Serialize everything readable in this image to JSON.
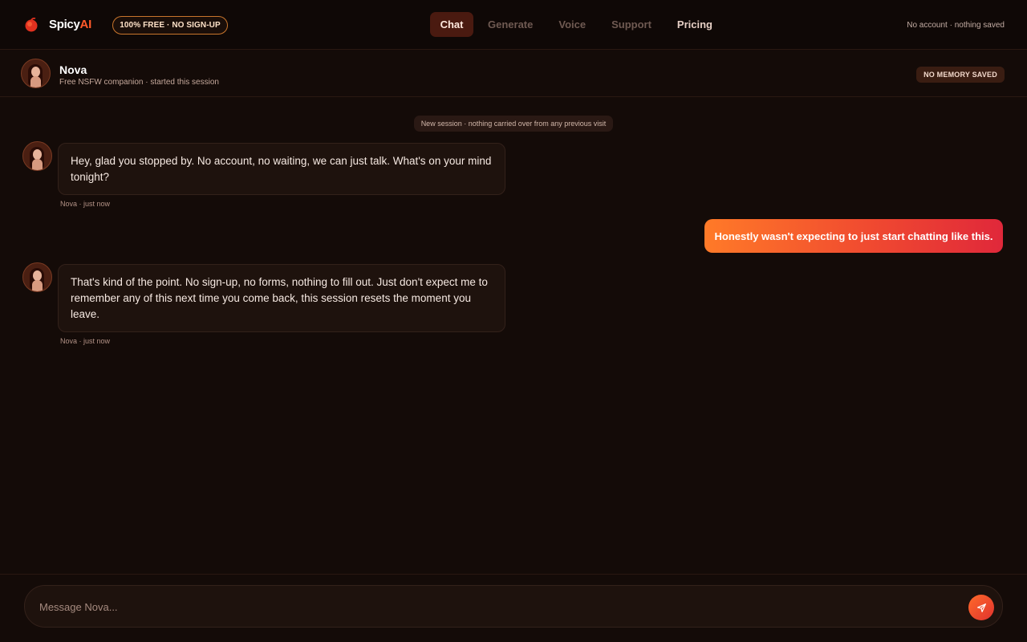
{
  "brand": {
    "name_main": "Spicy",
    "name_accent": "AI",
    "badge": "100% FREE · NO SIGN-UP"
  },
  "nav": {
    "items": [
      {
        "label": "Chat",
        "active": true
      },
      {
        "label": "Generate",
        "active": false
      },
      {
        "label": "Voice",
        "active": false
      },
      {
        "label": "Support",
        "active": false
      },
      {
        "label": "Pricing",
        "active": false
      }
    ],
    "status": "No account · nothing saved"
  },
  "companion": {
    "name": "Nova",
    "subtitle": "Free NSFW companion · started this session",
    "memory_badge": "NO MEMORY SAVED"
  },
  "chat": {
    "session_notice": "New session · nothing carried over from any previous visit",
    "messages": [
      {
        "from": "Nova",
        "text": "Hey, glad you stopped by. No account, no waiting, we can just talk. What's on your mind tonight?",
        "meta": "Nova · just now"
      },
      {
        "from": "user",
        "text": "Honestly wasn't expecting to just start chatting like this."
      },
      {
        "from": "Nova",
        "text": "That's kind of the point. No sign-up, no forms, nothing to fill out. Just don't expect me to remember any of this next time you come back, this session resets the moment you leave.",
        "meta": "Nova · just now"
      }
    ]
  },
  "composer": {
    "placeholder": "Message Nova..."
  },
  "colors": {
    "accent": "#ff5a2a",
    "background": "#140b08",
    "bubble": "#1e120d"
  }
}
